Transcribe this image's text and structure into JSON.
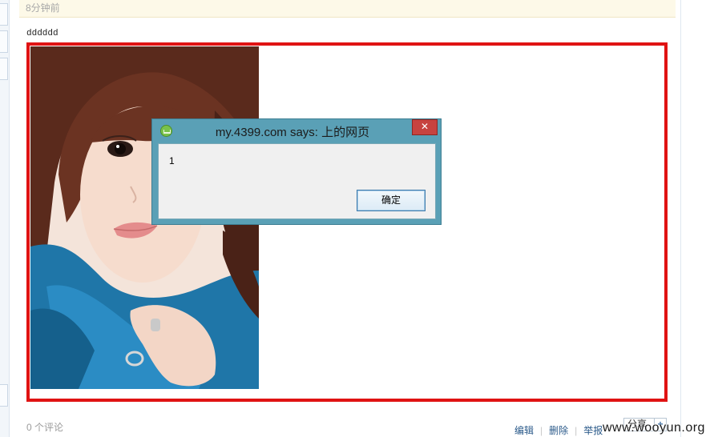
{
  "post": {
    "time_ago": "8分钟前",
    "text": "dddddd",
    "image_alt": "photo"
  },
  "dialog": {
    "title": "my.4399.com says: 上的网页",
    "close_glyph": "✕",
    "message": "1",
    "ok_label": "确定"
  },
  "footer": {
    "comments": "0 个评论",
    "actions": [
      "编辑",
      "删除",
      "举报"
    ],
    "share_label": "分享",
    "share_plus": "+"
  },
  "watermark": "www.wooyun.org",
  "colors": {
    "highlight_frame": "#e01313",
    "dialog_titlebar": "#5aa0b6",
    "close_button": "#c7433f",
    "link": "#2b5a8a"
  }
}
